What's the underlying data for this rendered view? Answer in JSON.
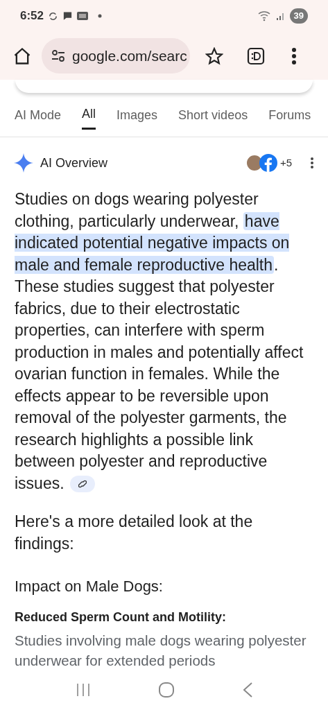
{
  "status_bar": {
    "time": "6:52",
    "battery": "39"
  },
  "address_bar": {
    "url": "google.com/searc"
  },
  "tabs": [
    {
      "label": "AI Mode",
      "selected": false
    },
    {
      "label": "All",
      "selected": true
    },
    {
      "label": "Images",
      "selected": false
    },
    {
      "label": "Short videos",
      "selected": false
    },
    {
      "label": "Forums",
      "selected": false
    }
  ],
  "ai_overview": {
    "title": "AI Overview",
    "sources_more": "+5",
    "paragraphs": [
      {
        "kind": "highlighted",
        "before": "Studies on dogs wearing polyester clothing, particularly underwear, ",
        "highlight": "have indicated potential negative impacts on male and female reproductive health",
        "after": ". These studies suggest that polyester fabrics, due to their electrostatic properties, can interfere with sperm production in males and potentially affect ovarian function in females. While the effects appear to be reversible upon removal of the polyester garments, the research highlights a possible link between polyester and reproductive issues.",
        "link": true
      },
      {
        "kind": "plain",
        "text": "Here's a more detailed look at the findings:"
      },
      {
        "kind": "heading",
        "text": "Impact on Male Dogs:"
      },
      {
        "kind": "subheading",
        "text": "Reduced Sperm Count and Motility:"
      },
      {
        "kind": "muted",
        "text": "Studies involving male dogs wearing polyester underwear for extended periods"
      }
    ]
  }
}
